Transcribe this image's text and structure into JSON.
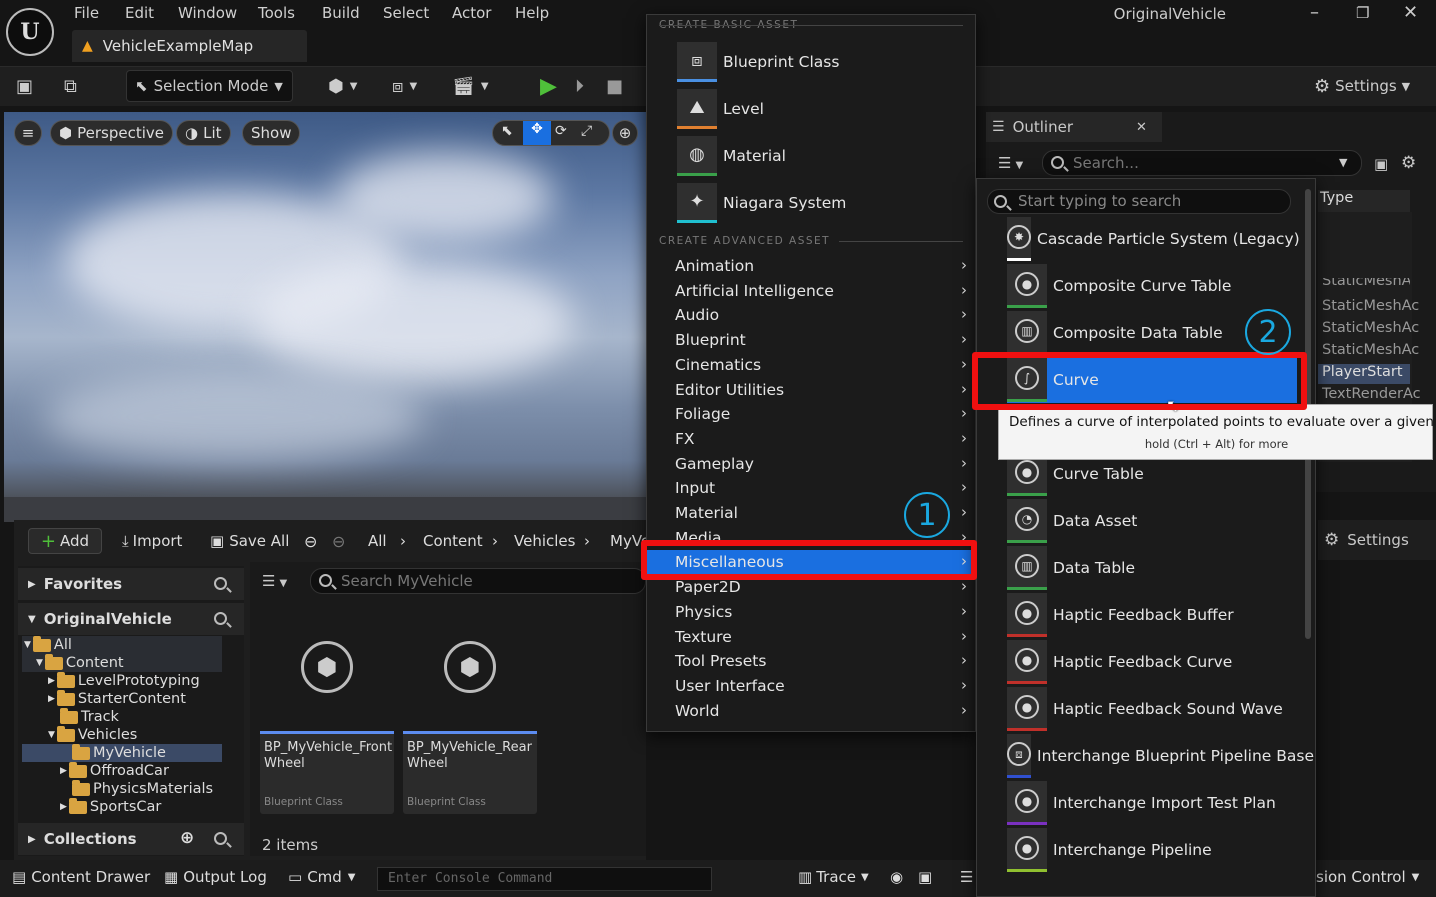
{
  "app": {
    "logo_glyph": "U",
    "window_title": "OriginalVehicle",
    "map_tab": "VehicleExampleMap",
    "menubar": [
      "File",
      "Edit",
      "Window",
      "Tools",
      "Build",
      "Select",
      "Actor",
      "Help"
    ]
  },
  "toolbar": {
    "selection_mode": "Selection Mode",
    "settings": "Settings"
  },
  "viewport": {
    "perspective": "Perspective",
    "lit": "Lit",
    "show": "Show"
  },
  "content_browser": {
    "add": "Add",
    "import": "Import",
    "save_all": "Save All",
    "breadcrumbs": [
      "All",
      "Content",
      "Vehicles",
      "MyVe"
    ],
    "search_placeholder": "Search MyVehicle",
    "favorites": "Favorites",
    "project": "OriginalVehicle",
    "tree": [
      "All",
      "Content",
      "LevelPrototyping",
      "StarterContent",
      "Track",
      "Vehicles",
      "MyVehicle",
      "OffroadCar",
      "PhysicsMaterials",
      "SportsCar"
    ],
    "collections": "Collections",
    "assets": [
      {
        "name": "BP_MyVehicle_Front Wheel",
        "type": "Blueprint Class"
      },
      {
        "name": "BP_MyVehicle_Rear Wheel",
        "type": "Blueprint Class"
      }
    ],
    "item_count": "2 items"
  },
  "statusbar": {
    "content_drawer": "Content Drawer",
    "output_log": "Output Log",
    "cmd": "Cmd",
    "console_placeholder": "Enter Console Command",
    "trace": "Trace",
    "source_control": "sion Control"
  },
  "outliner": {
    "title": "Outliner",
    "search_placeholder": "Search...",
    "type_header": "Type",
    "types": [
      "StaticMeshAc",
      "StaticMeshAc",
      "StaticMeshAc",
      "StaticMeshAc",
      "PlayerStart",
      "TextRenderAc"
    ],
    "details_settings": "Settings"
  },
  "menu": {
    "basic_header": "CREATE BASIC ASSET",
    "basic": [
      {
        "label": "Blueprint Class",
        "icon": "blueprint-class-icon"
      },
      {
        "label": "Level",
        "icon": "level-icon"
      },
      {
        "label": "Material",
        "icon": "material-icon"
      },
      {
        "label": "Niagara System",
        "icon": "niagara-system-icon"
      }
    ],
    "advanced_header": "CREATE ADVANCED ASSET",
    "advanced": [
      "Animation",
      "Artificial Intelligence",
      "Audio",
      "Blueprint",
      "Cinematics",
      "Editor Utilities",
      "Foliage",
      "FX",
      "Gameplay",
      "Input",
      "Material",
      "Media",
      "Miscellaneous",
      "Paper2D",
      "Physics",
      "Texture",
      "Tool Presets",
      "User Interface",
      "World"
    ],
    "selected": "Miscellaneous"
  },
  "submenu": {
    "search_placeholder": "Start typing to search",
    "items": [
      {
        "label": "Cascade Particle System (Legacy)",
        "accent": "#ffffff"
      },
      {
        "label": "Composite Curve Table",
        "accent": "#3aa04a"
      },
      {
        "label": "Composite Data Table",
        "accent": "#3aa04a"
      },
      {
        "label": "Curve",
        "accent": "#3aa04a"
      },
      {
        "label": "Curve Table",
        "accent": "#3aa04a"
      },
      {
        "label": "Data Asset",
        "accent": "#3aa04a"
      },
      {
        "label": "Data Table",
        "accent": "#3aa04a"
      },
      {
        "label": "Haptic Feedback Buffer",
        "accent": "#c0302a"
      },
      {
        "label": "Haptic Feedback Curve",
        "accent": "#c0302a"
      },
      {
        "label": "Haptic Feedback Sound Wave",
        "accent": "#c0302a"
      },
      {
        "label": "Interchange Blueprint Pipeline Base",
        "accent": "#3050d0"
      },
      {
        "label": "Interchange Import Test Plan",
        "accent": "#7a30c0"
      },
      {
        "label": "Interchange Pipeline",
        "accent": "#90c030"
      }
    ],
    "selected": "Curve"
  },
  "tooltip": {
    "text": "Defines a curve of interpolated points to evaluate over a given range",
    "hint": "hold (Ctrl + Alt) for more"
  },
  "annotations": {
    "step1": "1",
    "step2": "2"
  },
  "colors": {
    "accent_blue": "#1a6fe0",
    "annotation_red": "#f01010",
    "annotation_cyan": "#1aa8e0"
  }
}
